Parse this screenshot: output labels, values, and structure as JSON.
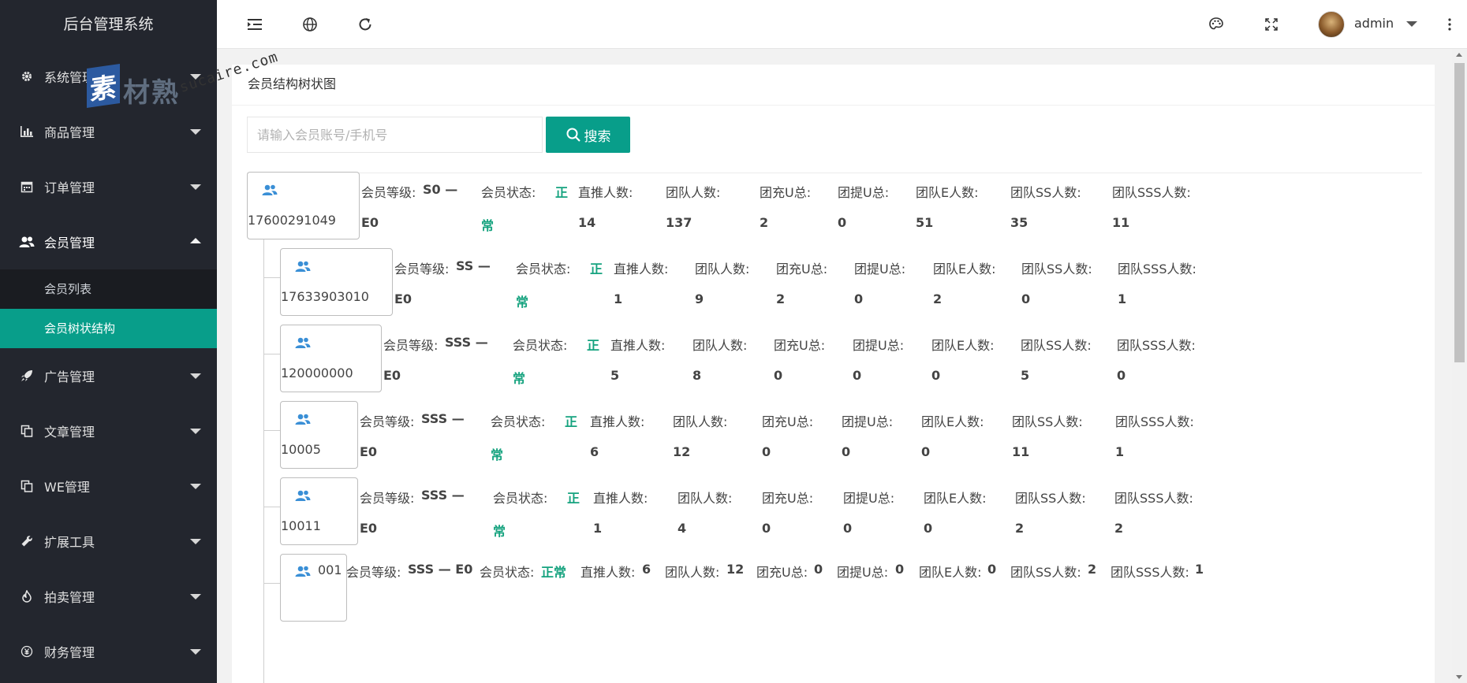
{
  "app_title": "后台管理系统",
  "watermark": {
    "brand_box": "素",
    "brand_cn": "材熟",
    "brand_url": "sucaire.com"
  },
  "sidebar": {
    "items": [
      {
        "label": "系统管理",
        "icon": "gear-icon"
      },
      {
        "label": "商品管理",
        "icon": "bar-chart-icon"
      },
      {
        "label": "订单管理",
        "icon": "calendar-icon"
      },
      {
        "label": "会员管理",
        "icon": "users-icon",
        "expanded": true
      },
      {
        "label": "广告管理",
        "icon": "rocket-icon"
      },
      {
        "label": "文章管理",
        "icon": "copy-icon"
      },
      {
        "label": "WE管理",
        "icon": "copy-icon"
      },
      {
        "label": "扩展工具",
        "icon": "wrench-icon"
      },
      {
        "label": "拍卖管理",
        "icon": "fire-icon"
      },
      {
        "label": "财务管理",
        "icon": "yen-icon"
      }
    ],
    "member_sub": [
      {
        "label": "会员列表",
        "active": false
      },
      {
        "label": "会员树状结构",
        "active": true
      }
    ],
    "accent_color": "#089e8a"
  },
  "topbar": {
    "icons": [
      "indent-icon",
      "globe-icon",
      "refresh-icon",
      "palette-icon",
      "fullscreen-icon",
      "more-vertical-icon"
    ],
    "username": "admin"
  },
  "page": {
    "title": "会员结构树状图",
    "search_placeholder": "请输入会员账号/手机号",
    "search_button": "搜索"
  },
  "labels": {
    "level": "会员等级:",
    "status": "会员状态:",
    "direct": "直推人数:",
    "team": "团队人数:",
    "charge": "团充U总:",
    "withdraw": "团提U总:",
    "team_e": "团队E人数:",
    "team_ss": "团队SS人数:",
    "team_sss": "团队SSS人数:"
  },
  "tree": [
    {
      "account": "17600291049",
      "level": "S0 —",
      "level2": "E0",
      "status1": "正",
      "status2": "常",
      "direct": "14",
      "team": "137",
      "charge": "2",
      "withdraw": "0",
      "team_e": "51",
      "team_ss": "35",
      "team_sss": "11"
    },
    {
      "account": "17633903010",
      "level": "SS —",
      "level2": "E0",
      "status1": "正",
      "status2": "常",
      "direct": "1",
      "team": "9",
      "charge": "2",
      "withdraw": "0",
      "team_e": "2",
      "team_ss": "0",
      "team_sss": "1"
    },
    {
      "account": "120000000",
      "level": "SSS —",
      "level2": "E0",
      "status1": "正",
      "status2": "常",
      "direct": "5",
      "team": "8",
      "charge": "0",
      "withdraw": "0",
      "team_e": "0",
      "team_ss": "5",
      "team_sss": "0"
    },
    {
      "account": "10005",
      "level": "SSS —",
      "level2": "E0",
      "status1": "正",
      "status2": "常",
      "direct": "6",
      "team": "12",
      "charge": "0",
      "withdraw": "0",
      "team_e": "0",
      "team_ss": "11",
      "team_sss": "1"
    },
    {
      "account": "10011",
      "level": "SSS —",
      "level2": "E0",
      "status1": "正",
      "status2": "常",
      "direct": "1",
      "team": "4",
      "charge": "0",
      "withdraw": "0",
      "team_e": "0",
      "team_ss": "2",
      "team_sss": "2"
    },
    {
      "account": "001",
      "level": "SSS — E0",
      "status": "正常",
      "direct": "6",
      "team": "12",
      "charge": "0",
      "withdraw": "0",
      "team_e": "0",
      "team_ss": "2",
      "team_sss": "1"
    }
  ]
}
